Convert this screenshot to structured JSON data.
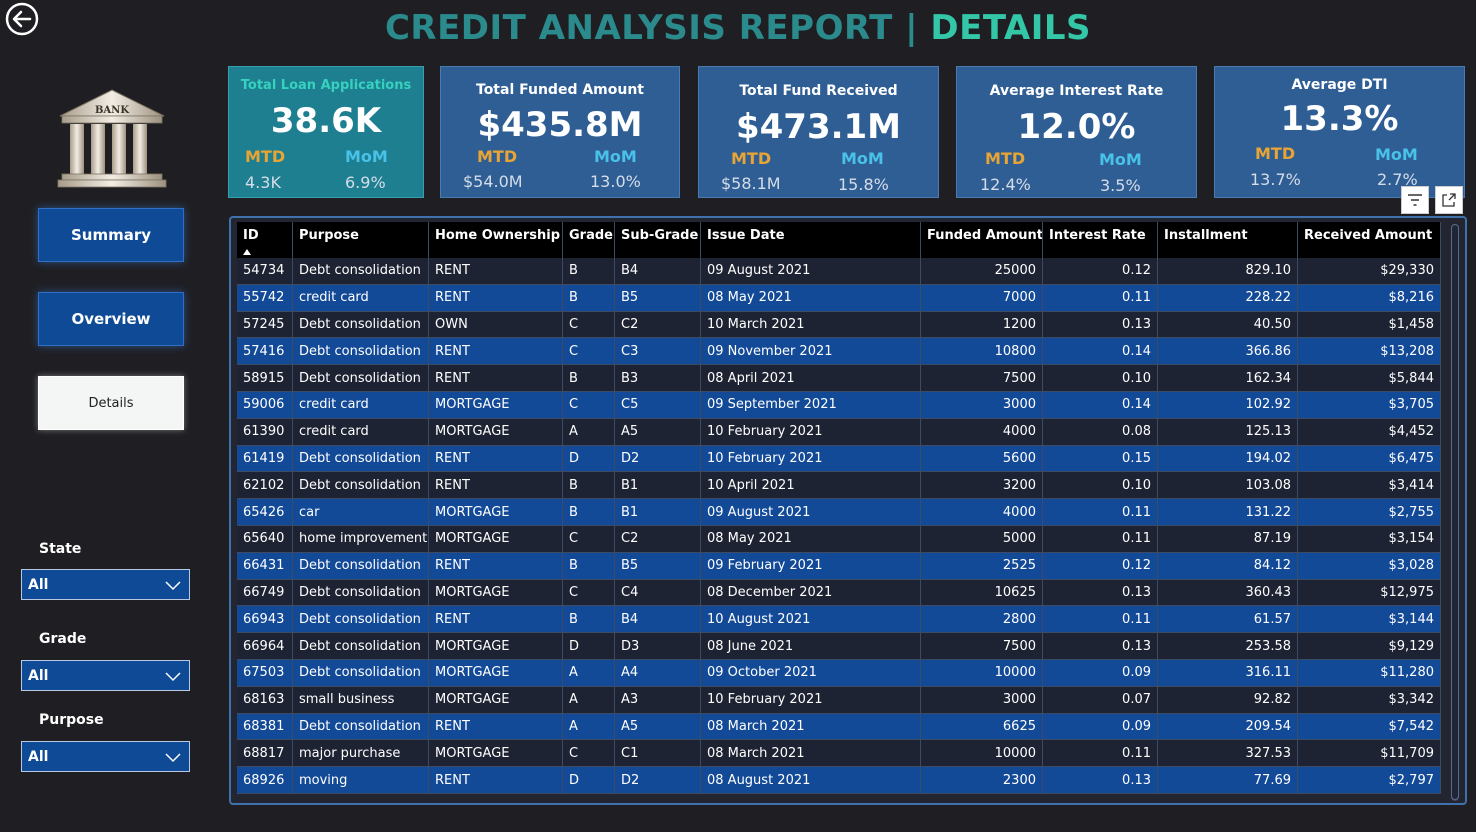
{
  "title": {
    "part1": "CREDIT ANALYSIS REPORT | ",
    "part2": "DETAILS"
  },
  "nav": [
    {
      "label": "Summary",
      "active": false
    },
    {
      "label": "Overview",
      "active": false
    },
    {
      "label": "Details",
      "active": true
    }
  ],
  "filters": [
    {
      "label": "State",
      "value": "All"
    },
    {
      "label": "Grade",
      "value": "All"
    },
    {
      "label": "Purpose",
      "value": "All"
    }
  ],
  "bank_logo_text": "BANK",
  "kpis": [
    {
      "label": "Total Loan Applications",
      "value": "38.6K",
      "mtd_label": "MTD",
      "mtd": "4.3K",
      "mom_label": "MoM",
      "mom": "6.9%"
    },
    {
      "label": "Total Funded Amount",
      "value": "$435.8M",
      "mtd_label": "MTD",
      "mtd": "$54.0M",
      "mom_label": "MoM",
      "mom": "13.0%"
    },
    {
      "label": "Total Fund Received",
      "value": "$473.1M",
      "mtd_label": "MTD",
      "mtd": "$58.1M",
      "mom_label": "MoM",
      "mom": "15.8%"
    },
    {
      "label": "Average Interest Rate",
      "value": "12.0%",
      "mtd_label": "MTD",
      "mtd": "12.4%",
      "mom_label": "MoM",
      "mom": "3.5%"
    },
    {
      "label": "Average DTI",
      "value": "13.3%",
      "mtd_label": "MTD",
      "mtd": "13.7%",
      "mom_label": "MoM",
      "mom": "2.7%"
    }
  ],
  "table": {
    "headers": [
      "ID",
      "Purpose",
      "Home Ownership",
      "Grade",
      "Sub-Grade",
      "Issue Date",
      "Funded Amount",
      "Interest Rate",
      "Installment",
      "Received Amount"
    ],
    "rows": [
      [
        "54734",
        "Debt consolidation",
        "RENT",
        "B",
        "B4",
        "09 August 2021",
        "25000",
        "0.12",
        "829.10",
        "$29,330"
      ],
      [
        "55742",
        "credit card",
        "RENT",
        "B",
        "B5",
        "08 May 2021",
        "7000",
        "0.11",
        "228.22",
        "$8,216"
      ],
      [
        "57245",
        "Debt consolidation",
        "OWN",
        "C",
        "C2",
        "10 March 2021",
        "1200",
        "0.13",
        "40.50",
        "$1,458"
      ],
      [
        "57416",
        "Debt consolidation",
        "RENT",
        "C",
        "C3",
        "09 November 2021",
        "10800",
        "0.14",
        "366.86",
        "$13,208"
      ],
      [
        "58915",
        "Debt consolidation",
        "RENT",
        "B",
        "B3",
        "08 April 2021",
        "7500",
        "0.10",
        "162.34",
        "$5,844"
      ],
      [
        "59006",
        "credit card",
        "MORTGAGE",
        "C",
        "C5",
        "09 September 2021",
        "3000",
        "0.14",
        "102.92",
        "$3,705"
      ],
      [
        "61390",
        "credit card",
        "MORTGAGE",
        "A",
        "A5",
        "10 February 2021",
        "4000",
        "0.08",
        "125.13",
        "$4,452"
      ],
      [
        "61419",
        "Debt consolidation",
        "RENT",
        "D",
        "D2",
        "10 February 2021",
        "5600",
        "0.15",
        "194.02",
        "$6,475"
      ],
      [
        "62102",
        "Debt consolidation",
        "RENT",
        "B",
        "B1",
        "10 April 2021",
        "3200",
        "0.10",
        "103.08",
        "$3,414"
      ],
      [
        "65426",
        "car",
        "MORTGAGE",
        "B",
        "B1",
        "09 August 2021",
        "4000",
        "0.11",
        "131.22",
        "$2,755"
      ],
      [
        "65640",
        "home improvement",
        "MORTGAGE",
        "C",
        "C2",
        "08 May 2021",
        "5000",
        "0.11",
        "87.19",
        "$3,154"
      ],
      [
        "66431",
        "Debt consolidation",
        "RENT",
        "B",
        "B5",
        "09 February 2021",
        "2525",
        "0.12",
        "84.12",
        "$3,028"
      ],
      [
        "66749",
        "Debt consolidation",
        "MORTGAGE",
        "C",
        "C4",
        "08 December 2021",
        "10625",
        "0.13",
        "360.43",
        "$12,975"
      ],
      [
        "66943",
        "Debt consolidation",
        "RENT",
        "B",
        "B4",
        "10 August 2021",
        "2800",
        "0.11",
        "61.57",
        "$3,144"
      ],
      [
        "66964",
        "Debt consolidation",
        "MORTGAGE",
        "D",
        "D3",
        "08 June 2021",
        "7500",
        "0.13",
        "253.58",
        "$9,129"
      ],
      [
        "67503",
        "Debt consolidation",
        "MORTGAGE",
        "A",
        "A4",
        "09 October 2021",
        "10000",
        "0.09",
        "316.11",
        "$11,280"
      ],
      [
        "68163",
        "small business",
        "MORTGAGE",
        "A",
        "A3",
        "10 February 2021",
        "3000",
        "0.07",
        "92.82",
        "$3,342"
      ],
      [
        "68381",
        "Debt consolidation",
        "RENT",
        "A",
        "A5",
        "08 March 2021",
        "6625",
        "0.09",
        "209.54",
        "$7,542"
      ],
      [
        "68817",
        "major purchase",
        "MORTGAGE",
        "C",
        "C1",
        "08 March 2021",
        "10000",
        "0.11",
        "327.53",
        "$11,709"
      ],
      [
        "68926",
        "moving",
        "RENT",
        "D",
        "D2",
        "08 August 2021",
        "2300",
        "0.13",
        "77.69",
        "$2,797"
      ]
    ]
  }
}
